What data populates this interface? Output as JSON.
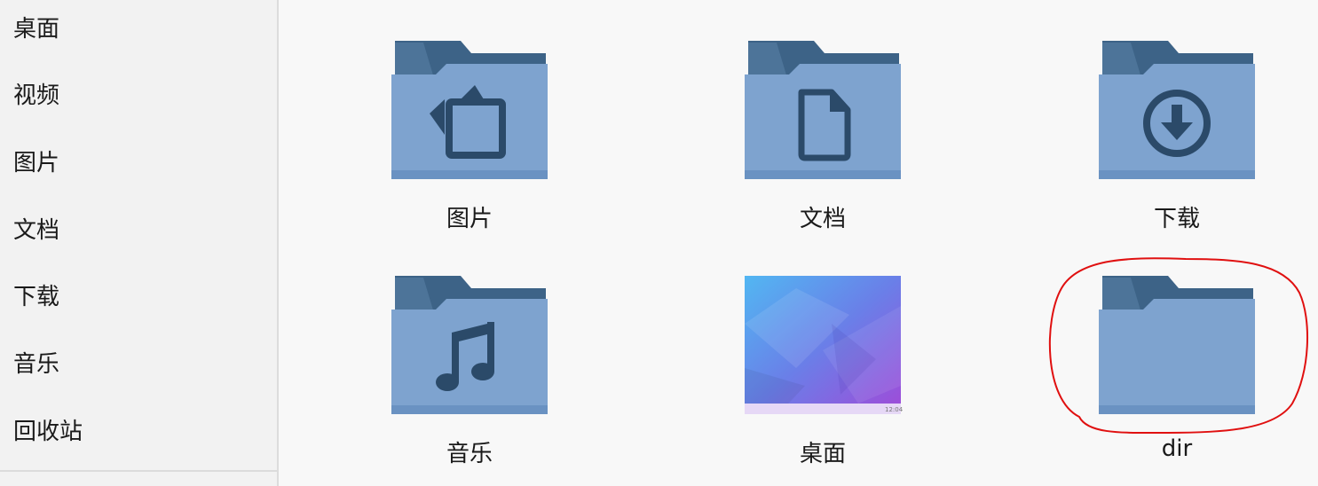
{
  "sidebar": {
    "items": [
      {
        "label": "桌面"
      },
      {
        "label": "视频"
      },
      {
        "label": "图片"
      },
      {
        "label": "文档"
      },
      {
        "label": "下载"
      },
      {
        "label": "音乐"
      },
      {
        "label": "回收站"
      }
    ]
  },
  "files": [
    {
      "label": "图片",
      "icon": "pictures-folder-icon"
    },
    {
      "label": "文档",
      "icon": "documents-folder-icon"
    },
    {
      "label": "下载",
      "icon": "downloads-folder-icon"
    },
    {
      "label": "音乐",
      "icon": "music-folder-icon"
    },
    {
      "label": "桌面",
      "icon": "desktop-thumbnail-icon"
    },
    {
      "label": "dir",
      "icon": "folder-icon"
    }
  ],
  "desktop_thumbnail": {
    "clock": "12:04"
  },
  "colors": {
    "folder_front": "#7ea3cf",
    "folder_back": "#3d6387",
    "glyph": "#2b4a69",
    "annotation": "#e01010"
  }
}
